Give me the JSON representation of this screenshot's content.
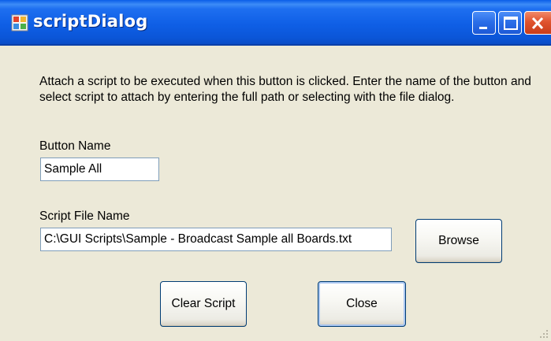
{
  "window": {
    "title": "scriptDialog"
  },
  "dialog": {
    "description": "Attach a script to be executed when this button is clicked.  Enter the name of the button and select script to attach by entering the full path or selecting with the file dialog.",
    "button_name_label": "Button Name",
    "button_name_value": "Sample All",
    "script_file_label": "Script File Name",
    "script_file_value": "C:\\GUI Scripts\\Sample - Broadcast Sample all Boards.txt",
    "browse_label": "Browse",
    "clear_script_label": "Clear Script",
    "close_label": "Close"
  },
  "icons": {
    "app": "app-icon",
    "minimize": "minimize-icon",
    "maximize": "maximize-icon",
    "close": "close-icon"
  },
  "colors": {
    "titlebar": "#0b5ade",
    "dialog_background": "#ece9d8",
    "close_button": "#e0532e",
    "textbox_border": "#7f9db9"
  }
}
